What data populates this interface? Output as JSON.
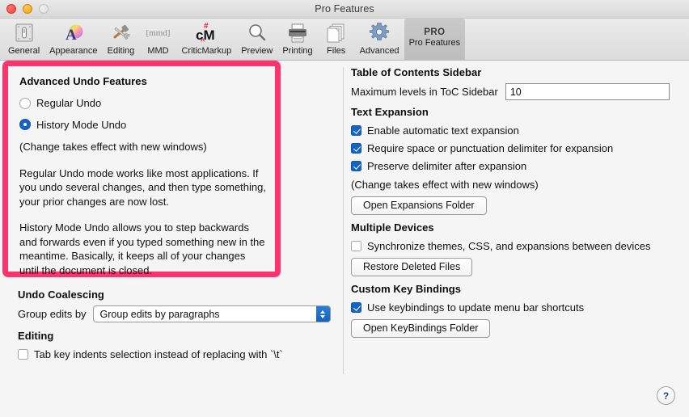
{
  "window": {
    "title": "Pro Features",
    "traffic_lights": [
      "close-red",
      "minimize-yellow",
      "zoom-disabled-gray"
    ]
  },
  "toolbar": {
    "items": [
      {
        "label": "General",
        "icon": "general-switch-icon"
      },
      {
        "label": "Appearance",
        "icon": "appearance-palette-icon"
      },
      {
        "label": "Editing",
        "icon": "editing-tools-icon"
      },
      {
        "label": "MMD",
        "icon": "mmd-icon",
        "icon_text": "[mmd]"
      },
      {
        "label": "CriticMarkup",
        "icon": "criticmarkup-icon",
        "icon_text": "cM"
      },
      {
        "label": "Preview",
        "icon": "preview-magnifier-icon"
      },
      {
        "label": "Printing",
        "icon": "printing-printer-icon"
      },
      {
        "label": "Files",
        "icon": "files-documents-icon"
      },
      {
        "label": "Advanced",
        "icon": "advanced-gear-icon"
      },
      {
        "label": "Pro Features",
        "icon": "pro-badge-icon",
        "icon_text": "PRO",
        "selected": true
      }
    ]
  },
  "left": {
    "highlight_color": "#fd3370",
    "advanced_undo": {
      "heading": "Advanced Undo Features",
      "options": [
        {
          "label": "Regular Undo",
          "selected": false
        },
        {
          "label": "History Mode Undo",
          "selected": true
        }
      ],
      "note": "(Change takes effect with new windows)",
      "paragraph_1": "Regular Undo mode works like most applications. If you undo several changes, and then type something, your prior changes are now lost.",
      "paragraph_2": "History Mode Undo allows you to step backwards and forwards even if you typed something new in the meantime. Basically, it keeps all of your changes until the document is closed."
    },
    "undo_coalescing": {
      "heading": "Undo Coalescing",
      "field_label": "Group edits by",
      "selected_option": "Group edits by paragraphs"
    },
    "editing": {
      "heading": "Editing",
      "tab_key_label": "Tab key indents selection instead of replacing with `\\t`",
      "tab_key_checked": false
    }
  },
  "right": {
    "toc": {
      "heading": "Table of Contents Sidebar",
      "field_label": "Maximum levels in ToC Sidebar",
      "field_value": "10"
    },
    "text_expansion": {
      "heading": "Text Expansion",
      "checkboxes": [
        {
          "label": "Enable automatic text expansion",
          "checked": true
        },
        {
          "label": "Require space or punctuation delimiter for expansion",
          "checked": true
        },
        {
          "label": "Preserve delimiter after expansion",
          "checked": true
        }
      ],
      "note": "(Change takes effect with new windows)",
      "button": "Open Expansions Folder"
    },
    "multiple_devices": {
      "heading": "Multiple Devices",
      "checkbox": {
        "label": "Synchronize themes, CSS, and expansions between devices",
        "checked": false
      },
      "button": "Restore Deleted Files"
    },
    "key_bindings": {
      "heading": "Custom Key Bindings",
      "checkbox": {
        "label": "Use keybindings to update menu bar shortcuts",
        "checked": true
      },
      "button": "Open KeyBindings Folder"
    },
    "help_button": "?"
  }
}
